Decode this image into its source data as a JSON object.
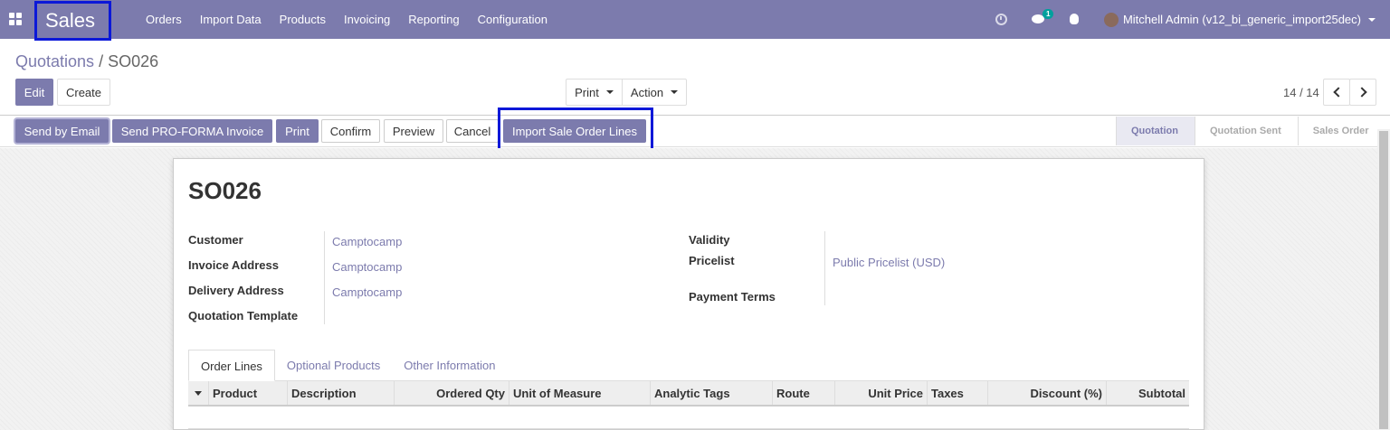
{
  "navbar": {
    "brand": "Sales",
    "menu": [
      "Orders",
      "Import Data",
      "Products",
      "Invoicing",
      "Reporting",
      "Configuration"
    ],
    "chat_badge": "1",
    "user": "Mitchell Admin (v12_bi_generic_import25dec)"
  },
  "breadcrumb": {
    "parent": "Quotations",
    "separator": " / ",
    "current": "SO026"
  },
  "controls": {
    "edit": "Edit",
    "create": "Create",
    "print": "Print",
    "action": "Action",
    "pager": "14 / 14"
  },
  "statusbar": {
    "buttons": [
      "Send by Email",
      "Send PRO-FORMA Invoice",
      "Print",
      "Confirm",
      "Preview",
      "Cancel",
      "Import Sale Order Lines"
    ],
    "stages": [
      "Quotation",
      "Quotation Sent",
      "Sales Order"
    ],
    "active_stage": "Quotation"
  },
  "form": {
    "title": "SO026",
    "left_fields": [
      {
        "label": "Customer",
        "value": "Camptocamp"
      },
      {
        "label": "Invoice Address",
        "value": "Camptocamp"
      },
      {
        "label": "Delivery Address",
        "value": "Camptocamp"
      },
      {
        "label": "Quotation Template",
        "value": ""
      }
    ],
    "right_fields": [
      {
        "label": "Validity",
        "value": ""
      },
      {
        "label": "Pricelist",
        "value": "Public Pricelist (USD)"
      },
      {
        "label": "Payment Terms",
        "value": ""
      }
    ],
    "tabs": [
      "Order Lines",
      "Optional Products",
      "Other Information"
    ],
    "columns": [
      "Product",
      "Description",
      "Ordered Qty",
      "Unit of Measure",
      "Analytic Tags",
      "Route",
      "Unit Price",
      "Taxes",
      "Discount (%)",
      "Subtotal"
    ]
  },
  "colors": {
    "brand": "#7c7bad",
    "highlight": "#0b18d8",
    "badge": "#00a09d"
  }
}
